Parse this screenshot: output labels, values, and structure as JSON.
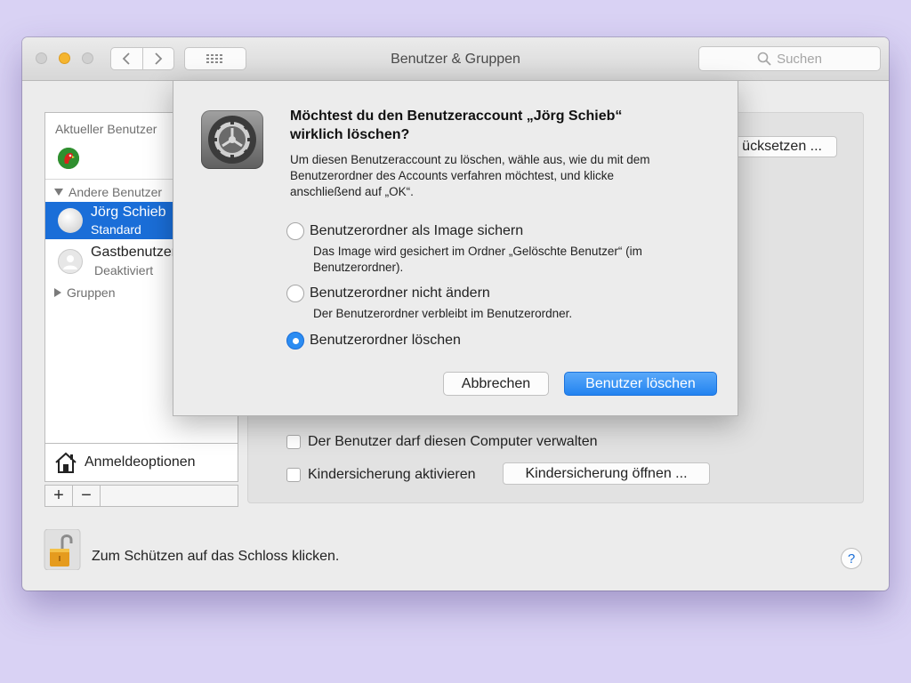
{
  "window": {
    "title": "Benutzer & Gruppen",
    "search_placeholder": "Suchen"
  },
  "sidebar": {
    "current_user_header": "Aktueller Benutzer",
    "other_users_header": "Andere Benutzer",
    "users": [
      {
        "name": "Jörg Schieb",
        "role": "Standard"
      },
      {
        "name": "Gastbenutzer",
        "role": "Deaktiviert"
      }
    ],
    "groups_label": "Gruppen",
    "login_options_label": "Anmeldeoptionen",
    "add_symbol": "+",
    "remove_symbol": "−"
  },
  "panel": {
    "reset_button_label": "ücksetzen ...",
    "admin_checkbox_label": "Der Benutzer darf diesen Computer verwalten",
    "parental_checkbox_label": "Kindersicherung aktivieren",
    "parental_open_button_label": "Kindersicherung öffnen ..."
  },
  "footer": {
    "lock_text": "Zum Schützen auf das Schloss klicken.",
    "help_symbol": "?"
  },
  "dialog": {
    "title_line1": "Möchtest du den Benutzeraccount „Jörg Schieb“",
    "title_line2": "wirklich löschen?",
    "message_line1": "Um diesen Benutzeraccount zu löschen, wähle aus, wie du mit dem",
    "message_line2": "Benutzerordner des Accounts verfahren möchtest, und klicke",
    "message_line3": "anschließend auf „OK“.",
    "options": [
      {
        "label": "Benutzerordner als Image sichern",
        "desc_line1": "Das Image wird gesichert im Ordner „Gelöschte Benutzer“ (im",
        "desc_line2": "Benutzerordner).",
        "selected": false
      },
      {
        "label": "Benutzerordner nicht ändern",
        "desc_line1": "Der Benutzerordner verbleibt im Benutzerordner.",
        "selected": false
      },
      {
        "label": "Benutzerordner löschen",
        "selected": true
      }
    ],
    "cancel_label": "Abbrechen",
    "confirm_label": "Benutzer löschen"
  },
  "colors": {
    "accent": "#1a6ed8",
    "background": "#d9d2f4",
    "minimize": "#f5b52f"
  }
}
